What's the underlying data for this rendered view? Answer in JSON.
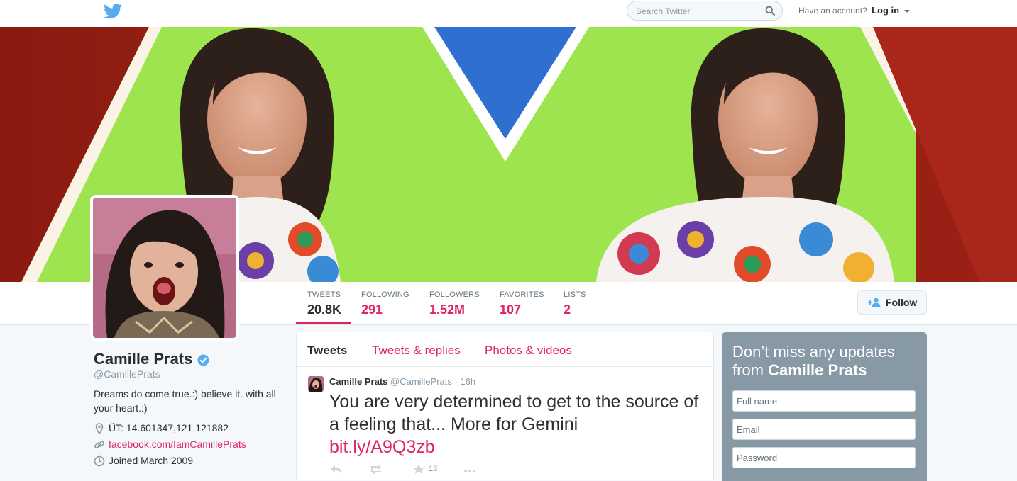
{
  "topbar": {
    "search_placeholder": "Search Twitter",
    "account_prompt": "Have an account?",
    "login_label": "Log in"
  },
  "colors": {
    "accent": "#e0245e",
    "header_bg": "#8e1d12",
    "header_green": "#9ee44e",
    "header_blue": "#2f6fd0",
    "signup_bg": "#8899a6"
  },
  "stats": [
    {
      "label": "TWEETS",
      "value": "20.8K"
    },
    {
      "label": "FOLLOWING",
      "value": "291"
    },
    {
      "label": "FOLLOWERS",
      "value": "1.52M"
    },
    {
      "label": "FAVORITES",
      "value": "107"
    },
    {
      "label": "LISTS",
      "value": "2"
    }
  ],
  "follow_label": "Follow",
  "profile": {
    "name": "Camille Prats",
    "handle": "@CamillePrats",
    "bio": "Dreams do come true.:) believe it. with all your heart.:)",
    "location": "ÜT: 14.601347,121.121882",
    "website": "facebook.com/IamCamillePrats",
    "joined": "Joined March 2009"
  },
  "timeline": {
    "tabs": [
      "Tweets",
      "Tweets & replies",
      "Photos & videos"
    ],
    "tweet": {
      "name": "Camille Prats",
      "handle": "@CamillePrats",
      "time": "· 16h",
      "text": "You are very determined to get to the source of a feeling that... More for Gemini",
      "link": "bit.ly/A9Q3zb",
      "favorite_count": "13"
    }
  },
  "signup": {
    "headline": "Don’t miss any updates from",
    "headline_name": "Camille Prats",
    "fullname_placeholder": "Full name",
    "email_placeholder": "Email",
    "password_placeholder": "Password"
  },
  "icons": [
    "twitter-bird-icon",
    "search-icon",
    "verified-icon",
    "location-icon",
    "link-icon",
    "calendar-icon",
    "follow-user-icon",
    "reply-icon",
    "retweet-icon",
    "favorite-icon",
    "more-icon"
  ]
}
